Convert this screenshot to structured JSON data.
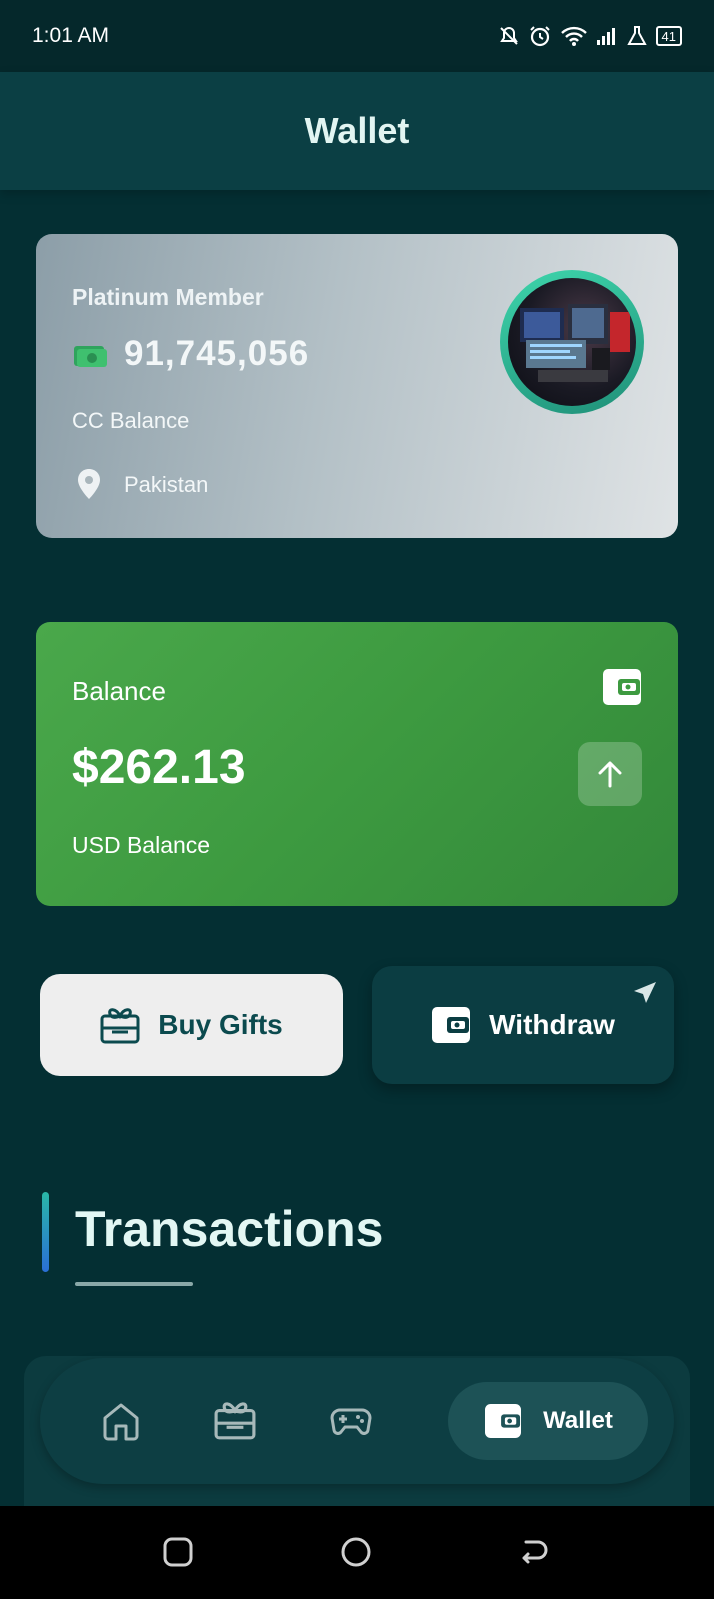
{
  "status_bar": {
    "time": "1:01 AM",
    "battery": "41"
  },
  "header": {
    "title": "Wallet"
  },
  "member_card": {
    "tier": "Platinum Member",
    "cc_amount": "91,745,056",
    "cc_label": "CC Balance",
    "location": "Pakistan"
  },
  "balance_card": {
    "label": "Balance",
    "amount": "$262.13",
    "sub_label": "USD Balance"
  },
  "actions": {
    "buy_gifts": "Buy Gifts",
    "withdraw": "Withdraw"
  },
  "transactions": {
    "title": "Transactions"
  },
  "bottom_nav": {
    "active_label": "Wallet"
  },
  "colors": {
    "background": "#042f33",
    "balance_green": "#3d9a40",
    "accent_teal": "#2ab7a7"
  },
  "icons": [
    "cash-icon",
    "location-pin-icon",
    "wallet-icon",
    "arrow-up-icon",
    "gift-icon",
    "send-icon",
    "home-icon",
    "gamepad-icon"
  ]
}
